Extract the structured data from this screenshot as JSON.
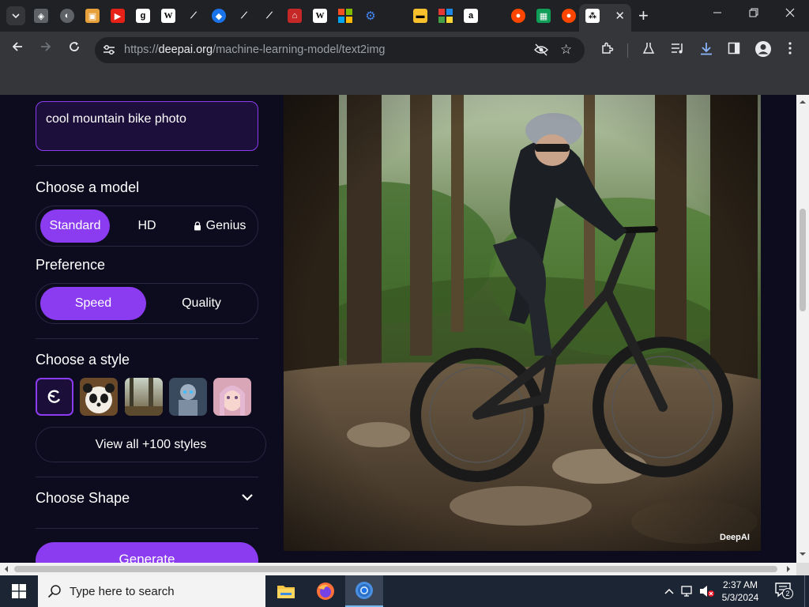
{
  "browser": {
    "url_scheme": "https://",
    "url_host": "deepai.org",
    "url_path": "/machine-learning-model/text2img",
    "tab_favicons": [
      "layers-icon",
      "globe-icon",
      "bookmark-icon",
      "youtube-icon",
      "text-icon",
      "wikipedia-icon",
      "feather-icon",
      "shield-icon",
      "feather-icon",
      "feather-icon",
      "home-icon",
      "wikipedia-icon",
      "microsoft-icon",
      "gear-icon",
      "cash-icon",
      "grid-icon",
      "amazon-icon",
      "reddit-icon",
      "sheets-icon",
      "reddit-icon",
      "deepai-icon"
    ],
    "new_tab_label": "+",
    "close_label": "✕"
  },
  "sidebar": {
    "prompt_value": "cool mountain bike photo",
    "model_title": "Choose a model",
    "models": [
      {
        "label": "Standard",
        "active": true
      },
      {
        "label": "HD",
        "active": false
      },
      {
        "label": "Genius",
        "active": false,
        "locked": true
      }
    ],
    "preference_title": "Preference",
    "preferences": [
      {
        "label": "Speed",
        "active": true
      },
      {
        "label": "Quality",
        "active": false
      }
    ],
    "style_title": "Choose a style",
    "styles": [
      "none-style-icon",
      "panda-style",
      "forest-style",
      "robot-style",
      "portrait-style"
    ],
    "view_all_label": "View all +100 styles",
    "shape_title": "Choose Shape",
    "generate_label": "Generate"
  },
  "result": {
    "watermark": "DeepAI"
  },
  "taskbar": {
    "search_placeholder": "Type here to search",
    "time": "2:37 AM",
    "date": "5/3/2024",
    "notification_count": "2"
  },
  "colors": {
    "accent": "#8b3cf0",
    "page_bg": "#0d0b1e",
    "browser_dark": "#202124",
    "browser_toolbar": "#35363a"
  }
}
